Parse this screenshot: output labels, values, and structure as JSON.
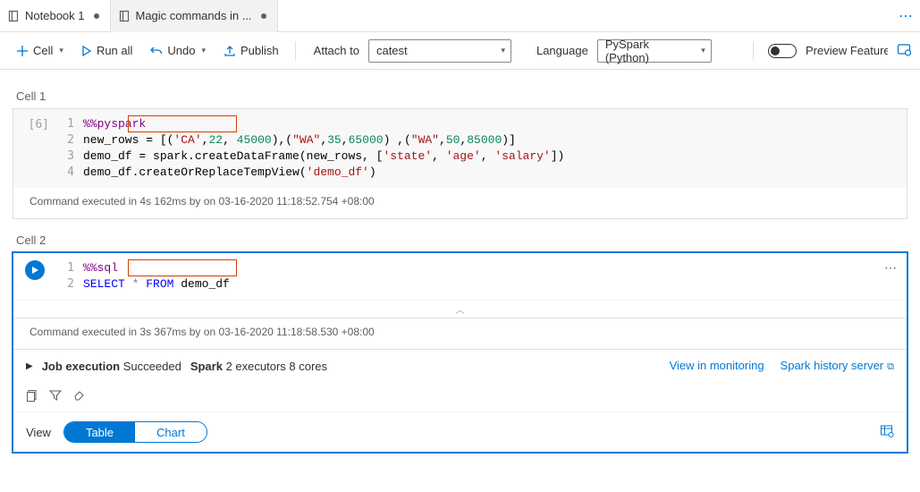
{
  "tabs": {
    "t1": {
      "title": "Notebook 1"
    },
    "t2": {
      "title": "Magic commands in ..."
    }
  },
  "toolbar": {
    "cell": "Cell",
    "runall": "Run all",
    "undo": "Undo",
    "publish": "Publish",
    "attach_label": "Attach to",
    "attach_value": "catest",
    "lang_label": "Language",
    "lang_value": "PySpark (Python)",
    "preview": "Preview Features"
  },
  "cell1": {
    "label": "Cell 1",
    "exec_count": "[6]",
    "ln1": "1",
    "ln2": "2",
    "ln3": "3",
    "ln4": "4",
    "magic": "%%pyspark",
    "l2a": "new_rows = [(",
    "l2b": "'CA'",
    "l2c": ",",
    "l2d": "22",
    "l2e": ", ",
    "l2f": "45000",
    "l2g": "),(",
    "l2h": "\"WA\"",
    "l2i": ",",
    "l2j": "35",
    "l2k": ",",
    "l2l": "65000",
    "l2m": ") ,(",
    "l2n": "\"WA\"",
    "l2o": ",",
    "l2p": "50",
    "l2q": ",",
    "l2r": "85000",
    "l2s": ")]",
    "l3a": "demo_df = spark.createDataFrame(new_rows, [",
    "l3b": "'state'",
    "l3c": ", ",
    "l3d": "'age'",
    "l3e": ", ",
    "l3f": "'salary'",
    "l3g": "])",
    "l4a": "demo_df.createOrReplaceTempView(",
    "l4b": "'demo_df'",
    "l4c": ")",
    "status": "Command executed in 4s 162ms by       on 03-16-2020 11:18:52.754 +08:00"
  },
  "cell2": {
    "label": "Cell 2",
    "ln1": "1",
    "ln2": "2",
    "magic": "%%sql",
    "l2a": "SELECT",
    "l2b": " * ",
    "l2c": "FROM",
    "l2d": " demo_df",
    "status": "Command executed in 3s 367ms by       on 03-16-2020 11:18:58.530 +08:00",
    "job_label": "Job execution",
    "job_status": "Succeeded",
    "spark_label": "Spark",
    "spark_info": "2 executors 8 cores",
    "link_monitor": "View in monitoring",
    "link_history": "Spark history server",
    "view_label": "View",
    "view_table": "Table",
    "view_chart": "Chart"
  }
}
